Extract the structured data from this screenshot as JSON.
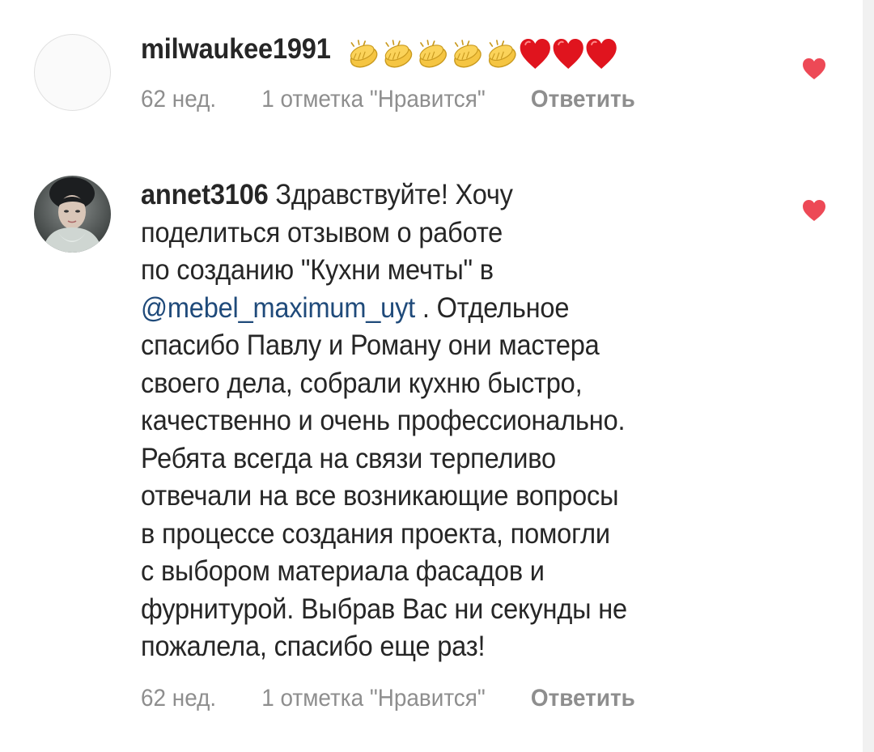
{
  "comments": [
    {
      "username": "milwaukee1991",
      "emoji_sequence": [
        "clapping-hands",
        "clapping-hands",
        "clapping-hands",
        "clapping-hands",
        "clapping-hands",
        "red-heart",
        "red-heart",
        "red-heart"
      ],
      "meta": {
        "time": "62 нед.",
        "likes": "1 отметка \"Нравится\"",
        "reply": "Ответить"
      },
      "like_icon": "heart-icon",
      "like_color": "#ed4956"
    },
    {
      "username": "annet3106",
      "lines": {
        "l1": "Здравствуйте! Хочу",
        "l2": "поделиться отзывом о работе",
        "l3": "по созданию \"Кухни мечты\"  в",
        "mention": "@mebel_maximum_uyt",
        "l4_rest": " . Отдельное",
        "l5": "спасибо Павлу и Роману они мастера",
        "l6": "своего дела, собрали кухню быстро,",
        "l7": "качественно и очень профессионально.",
        "l8": "Ребята всегда на связи терпеливо",
        "l9": "отвечали на все возникающие вопросы",
        "l10": "в процессе создания проекта, помогли",
        "l11": "с выбором материала фасадов и",
        "l12": "фурнитурой. Выбрав Вас ни секунды не",
        "l13": "пожалела, спасибо еще раз!"
      },
      "meta": {
        "time": "62 нед.",
        "likes": "1 отметка \"Нравится\"",
        "reply": "Ответить"
      },
      "like_icon": "heart-icon",
      "like_color": "#ed4956"
    }
  ],
  "colors": {
    "text": "#262626",
    "meta": "#8e8e8e",
    "mention": "#1f4a7a",
    "like": "#ed4956"
  }
}
